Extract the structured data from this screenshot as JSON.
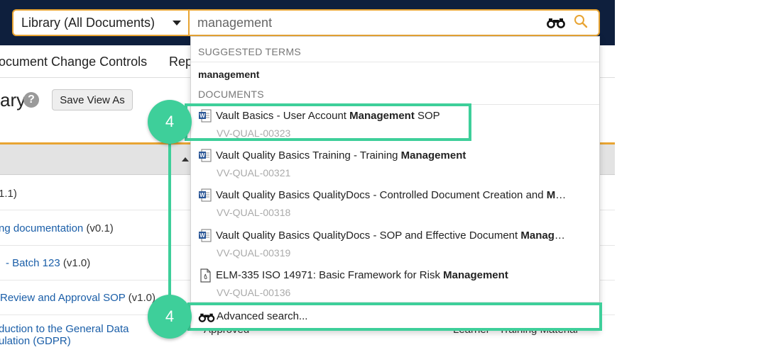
{
  "header": {
    "scope_select": "Library (All Documents)",
    "search_value": "management"
  },
  "tabs": [
    "ocument Change Controls",
    "Rep"
  ],
  "library": {
    "title": "ary",
    "help_glyph": "?",
    "save_view_label": "Save View As"
  },
  "rows": [
    {
      "link": "",
      "version": "1.1)"
    },
    {
      "link": "ng documentation",
      "version": "(v0.1)"
    },
    {
      "link": "- Batch 123",
      "version": "(v1.0)"
    },
    {
      "link": "Review and Approval SOP",
      "version": "(v1.0)"
    },
    {
      "link": "duction to the General Data",
      "link2": "ulation (GDPR)",
      "version": ""
    }
  ],
  "row_partial": {
    "status": "Approved",
    "type": "Learner - Training Material"
  },
  "dropdown": {
    "suggested_header": "SUGGESTED TERMS",
    "suggested_term": "management",
    "documents_header": "DOCUMENTS",
    "documents": [
      {
        "pre": "Vault Basics - User Account ",
        "bold": "Management",
        "post": " SOP",
        "number": "VV-QUAL-00323",
        "icon": "word-doc-icon"
      },
      {
        "pre": "Vault Quality Basics Training - Training ",
        "bold": "Management",
        "post": "",
        "number": "VV-QUAL-00321",
        "icon": "word-doc-icon"
      },
      {
        "pre": "Vault Quality Basics QualityDocs - Controlled Document Creation and ",
        "bold": "Management",
        "post": "",
        "number": "VV-QUAL-00318",
        "icon": "word-doc-icon"
      },
      {
        "pre": "Vault Quality Basics QualityDocs - SOP and Effective Document ",
        "bold": "Management",
        "post": "",
        "number": "VV-QUAL-00319",
        "icon": "word-doc-icon"
      },
      {
        "pre": "ELM-335 ISO 14971: Basic Framework for Risk ",
        "bold": "Management",
        "post": "",
        "number": "VV-QUAL-00136",
        "icon": "file-doc-icon"
      }
    ],
    "advanced_search_label": "Advanced search..."
  },
  "callouts": [
    {
      "label": "4"
    },
    {
      "label": "4"
    }
  ],
  "colors": {
    "header_bg": "#0e1f3d",
    "search_border": "#e8a433",
    "callout": "#3ecf9a",
    "link": "#1a5ea8"
  }
}
